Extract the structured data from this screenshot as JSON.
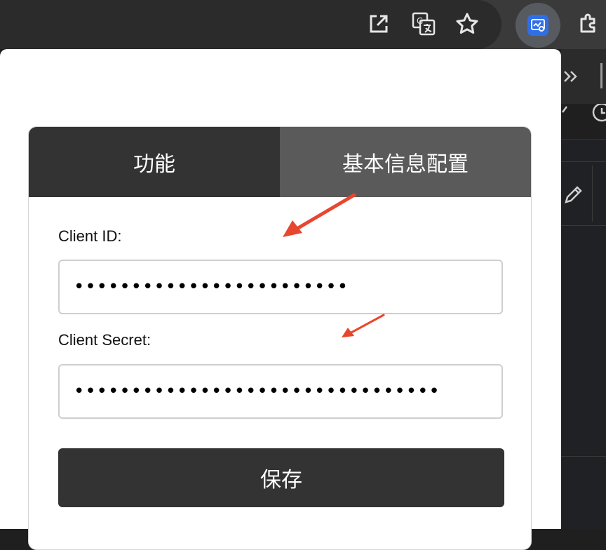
{
  "browser": {
    "toolbar_icons": [
      "open-in-new-icon",
      "translate-icon",
      "bookmark-star-icon",
      "extension-active-icon",
      "extensions-puzzle-icon"
    ],
    "colors": {
      "toolbar": "#2b2b2b",
      "extension_badge": "#2f6fe6"
    }
  },
  "popup": {
    "tabs": [
      {
        "label": "功能",
        "active": true
      },
      {
        "label": "基本信息配置",
        "active": false
      }
    ],
    "fields": {
      "client_id": {
        "label": "Client ID:",
        "value": "••••••••••••••••••••••••"
      },
      "client_secret": {
        "label": "Client Secret:",
        "value": "••••••••••••••••••••••••••••••••"
      }
    },
    "save_label": "保存",
    "colors": {
      "tab_active": "#333333",
      "tab_inactive": "#5a5a5a",
      "button": "#333333",
      "annotation_arrow": "#e8472f"
    }
  }
}
